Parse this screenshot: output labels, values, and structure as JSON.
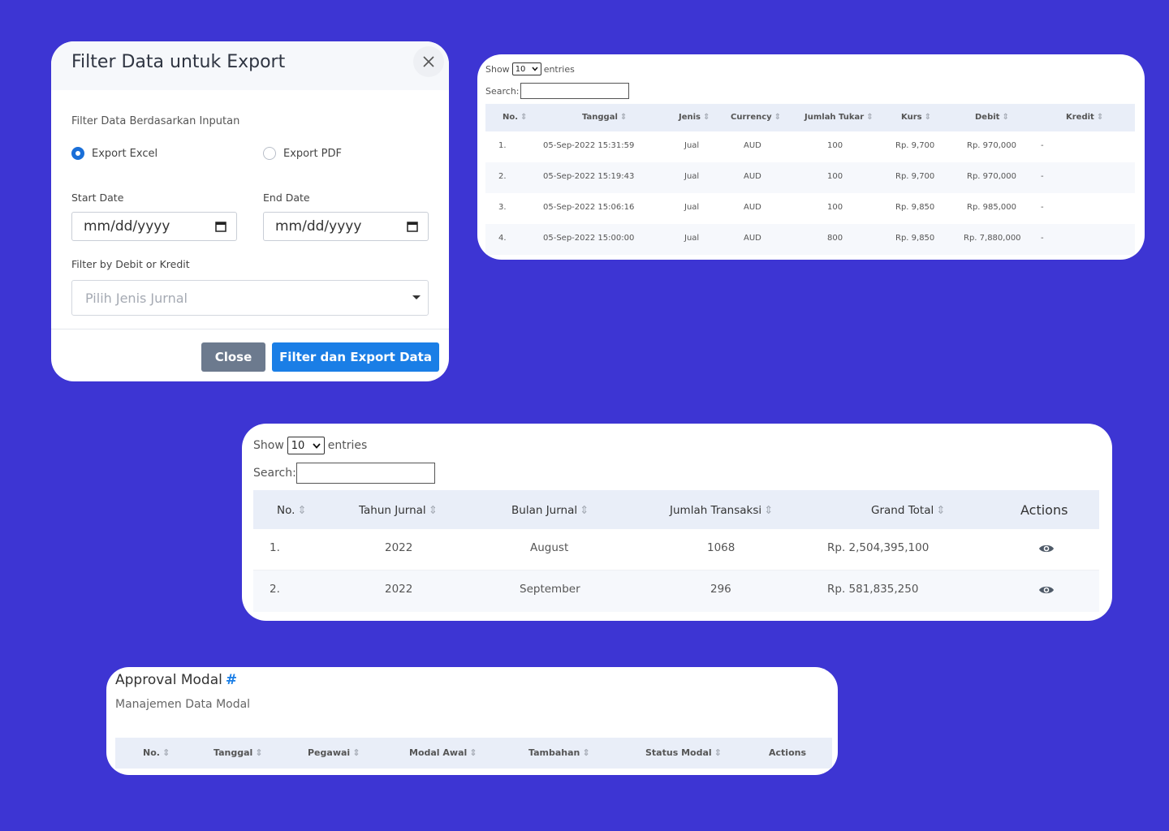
{
  "modal": {
    "title": "Filter Data untuk Export",
    "filter_label": "Filter Data Berdasarkan Inputan",
    "radio_excel": "Export Excel",
    "radio_pdf": "Export PDF",
    "start_label": "Start Date",
    "end_label": "End Date",
    "start_value": "mm/dd/yyyy",
    "end_value": "mm/dd/yyyy",
    "debit_kredit_label": "Filter by Debit or Kredit",
    "select_placeholder": "Pilih Jenis Jurnal",
    "close_label": "Close",
    "export_label": "Filter dan Export Data"
  },
  "table1": {
    "show_label": "Show",
    "page_size": "10",
    "entries_label": "entries",
    "search_label": "Search:",
    "headers": [
      "No.",
      "Tanggal",
      "Jenis",
      "Currency",
      "Jumlah Tukar",
      "Kurs",
      "Debit",
      "Kredit"
    ],
    "rows": [
      [
        "1.",
        "05-Sep-2022 15:31:59",
        "Jual",
        "AUD",
        "100",
        "Rp. 9,700",
        "Rp. 970,000",
        "-"
      ],
      [
        "2.",
        "05-Sep-2022 15:19:43",
        "Jual",
        "AUD",
        "100",
        "Rp. 9,700",
        "Rp. 970,000",
        "-"
      ],
      [
        "3.",
        "05-Sep-2022 15:06:16",
        "Jual",
        "AUD",
        "100",
        "Rp. 9,850",
        "Rp. 985,000",
        "-"
      ],
      [
        "4.",
        "05-Sep-2022 15:00:00",
        "Jual",
        "AUD",
        "800",
        "Rp. 9,850",
        "Rp. 7,880,000",
        "-"
      ]
    ]
  },
  "table2": {
    "show_label": "Show",
    "page_size": "10",
    "entries_label": "entries",
    "search_label": "Search:",
    "headers": [
      "No.",
      "Tahun Jurnal",
      "Bulan Jurnal",
      "Jumlah Transaksi",
      "Grand Total",
      "Actions"
    ],
    "rows": [
      [
        "1.",
        "2022",
        "August",
        "1068",
        "Rp. 2,504,395,100"
      ],
      [
        "2.",
        "2022",
        "September",
        "296",
        "Rp. 581,835,250"
      ]
    ]
  },
  "approval": {
    "title": "Approval Modal",
    "hash": "#",
    "subtitle": "Manajemen Data Modal",
    "headers": [
      "No.",
      "Tanggal",
      "Pegawai",
      "Modal Awal",
      "Tambahan",
      "Status Modal",
      "Actions"
    ]
  },
  "colors": {
    "background": "#3d35d3",
    "primary": "#1a7ee6",
    "secondary_button": "#6c7a8e",
    "table_header": "#e9eef8"
  },
  "icons": {
    "close": "close-icon",
    "calendar": "calendar-icon",
    "dropdown": "caret-down-icon",
    "sort": "sort-icon",
    "view": "eye-icon"
  }
}
